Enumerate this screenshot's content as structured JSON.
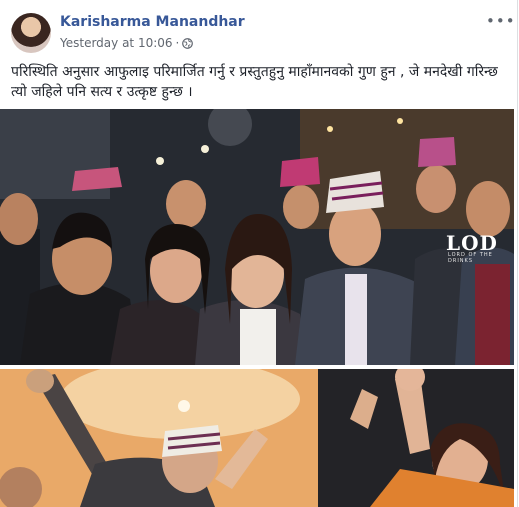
{
  "post": {
    "author": "Karisharma Manandhar",
    "timestamp": "Yesterday at 10:06",
    "separator": "·",
    "audience_icon": "globe-icon",
    "more_icon": "more-options-icon",
    "more_label": "•••",
    "text": "परिस्थिति अनुसार आफुलाइ परिमार्जित गर्नु र प्रस्तुतहुनु माहाँमानवको गुण हुन , जे मनदेखी गरिन्छ त्यो जहिले पनि सत्य र उत्कृष्ट हुन्छ ।"
  },
  "photos": {
    "watermark": "LOD",
    "watermark_sub": "LORD OF THE DRINKS"
  },
  "colors": {
    "author": "#385898",
    "meta": "#616770",
    "text": "#1d2129"
  }
}
